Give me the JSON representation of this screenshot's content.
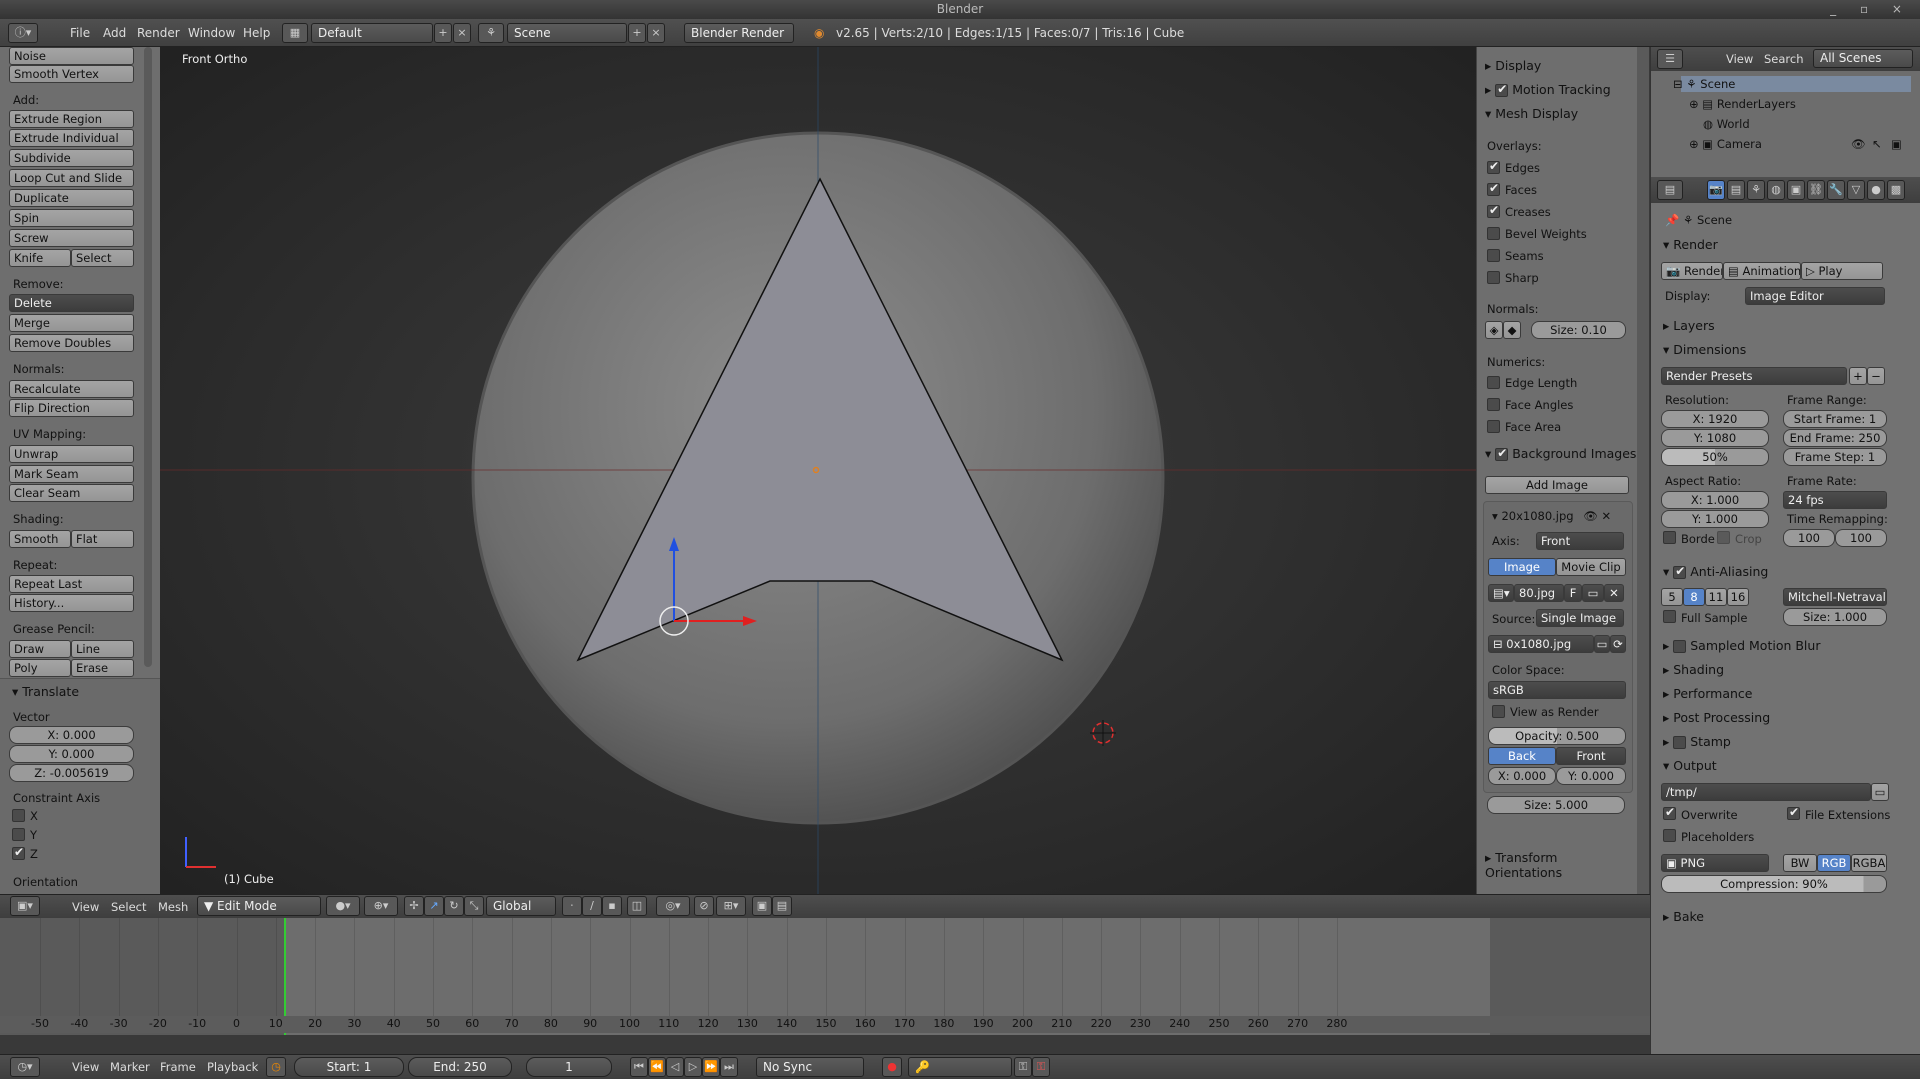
{
  "window": {
    "title": "Blender"
  },
  "topbar": {
    "menus": [
      "File",
      "Add",
      "Render",
      "Window",
      "Help"
    ],
    "layout": "Default",
    "scene": "Scene",
    "engine": "Blender Render",
    "stats": "v2.65 | Verts:2/10 | Edges:1/15 | Faces:0/7 | Tris:16 | Cube"
  },
  "toolshelf": {
    "top": [
      "Noise",
      "Smooth Vertex"
    ],
    "add_label": "Add:",
    "add": [
      "Extrude Region",
      "Extrude Individual",
      "Subdivide",
      "Loop Cut and Slide",
      "Duplicate",
      "Spin",
      "Screw"
    ],
    "knife": "Knife",
    "select": "Select",
    "remove_label": "Remove:",
    "delete": "Delete",
    "merge": "Merge",
    "remove_doubles": "Remove Doubles",
    "normals_label": "Normals:",
    "recalculate": "Recalculate",
    "flip": "Flip Direction",
    "uv_label": "UV Mapping:",
    "unwrap": "Unwrap",
    "mark_seam": "Mark Seam",
    "clear_seam": "Clear Seam",
    "shading_label": "Shading:",
    "smooth": "Smooth",
    "flat": "Flat",
    "repeat_label": "Repeat:",
    "repeat_last": "Repeat Last",
    "history": "History...",
    "gp_label": "Grease Pencil:",
    "draw": "Draw",
    "line": "Line",
    "poly": "Poly",
    "erase": "Erase"
  },
  "operator": {
    "title": "Translate",
    "vector_label": "Vector",
    "x": "X: 0.000",
    "y": "Y: 0.000",
    "z": "Z: -0.005619",
    "constraint_label": "Constraint Axis",
    "cx": "X",
    "cy": "Y",
    "cz": "Z",
    "orientation_label": "Orientation"
  },
  "viewport": {
    "view_name": "Front Ortho",
    "object": "(1) Cube"
  },
  "properties_n": {
    "display": "Display",
    "motion_tracking": "Motion Tracking",
    "mesh_display": "Mesh Display",
    "overlays": "Overlays:",
    "edges": "Edges",
    "faces": "Faces",
    "creases": "Creases",
    "bevel": "Bevel Weights",
    "seams": "Seams",
    "sharp": "Sharp",
    "normals": "Normals:",
    "size": "Size: 0.10",
    "numerics": "Numerics:",
    "edge_length": "Edge Length",
    "face_angles": "Face Angles",
    "face_area": "Face Area",
    "bg_images": "Background Images",
    "add_image": "Add Image",
    "img_name": "20x1080.jpg",
    "axis_label": "Axis:",
    "axis_value": "Front",
    "image_tab": "Image",
    "movie_tab": "Movie Clip",
    "img_field": "80.jpg",
    "f": "F",
    "source_label": "Source:",
    "source_value": "Single Image",
    "file": "0x1080.jpg",
    "colorspace_label": "Color Space:",
    "colorspace": "sRGB",
    "view_render": "View as Render",
    "opacity": "Opacity: 0.500",
    "back": "Back",
    "front": "Front",
    "ox": "X: 0.000",
    "oy": "Y: 0.000",
    "bsize": "Size: 5.000",
    "transform_orient": "Transform Orientations"
  },
  "outliner": {
    "view": "View",
    "search": "Search",
    "scenes": "All Scenes",
    "items": [
      "Scene",
      "RenderLayers",
      "World",
      "Camera"
    ]
  },
  "render_props": {
    "scene": "Scene",
    "render": "Render",
    "render_btn": "Render",
    "animation_btn": "Animation",
    "play_btn": "Play",
    "display_label": "Display:",
    "display_value": "Image Editor",
    "layers": "Layers",
    "dimensions": "Dimensions",
    "presets": "Render Presets",
    "resolution": "Resolution:",
    "res_x": "X: 1920",
    "res_y": "Y: 1080",
    "res_pct": "50%",
    "frame_range": "Frame Range:",
    "start": "Start Frame: 1",
    "end": "End Frame: 250",
    "step": "Frame Step: 1",
    "aspect": "Aspect Ratio:",
    "ax": "X: 1.000",
    "ay": "Y: 1.000",
    "frame_rate": "Frame Rate:",
    "fps": "24 fps",
    "time_remap": "Time Remapping:",
    "old": "100",
    "new": "100",
    "border": "Borde",
    "crop": "Crop",
    "aa": "Anti-Aliasing",
    "aa_vals": [
      "5",
      "8",
      "11",
      "16"
    ],
    "filter": "Mitchell-Netravali",
    "full_sample": "Full Sample",
    "aa_size": "Size: 1.000",
    "motion_blur": "Sampled Motion Blur",
    "shading": "Shading",
    "performance": "Performance",
    "post": "Post Processing",
    "stamp": "Stamp",
    "output": "Output",
    "path": "/tmp/",
    "overwrite": "Overwrite",
    "file_ext": "File Extensions",
    "placeholders": "Placeholders",
    "format": "PNG",
    "bw": "BW",
    "rgb": "RGB",
    "rgba": "RGBA",
    "compression": "Compression: 90%",
    "bake": "Bake"
  },
  "viewbar": {
    "view": "View",
    "select": "Select",
    "mesh": "Mesh",
    "mode": "Edit Mode",
    "orient": "Global"
  },
  "timeline": {
    "ticks": [
      "-50",
      "-40",
      "-30",
      "-20",
      "-10",
      "0",
      "10",
      "20",
      "30",
      "40",
      "50",
      "60",
      "70",
      "80",
      "90",
      "100",
      "110",
      "120",
      "130",
      "140",
      "150",
      "160",
      "170",
      "180",
      "190",
      "200",
      "210",
      "220",
      "230",
      "240",
      "250",
      "260",
      "270",
      "280"
    ],
    "view": "View",
    "marker": "Marker",
    "frame": "Frame",
    "playback": "Playback",
    "start": "Start: 1",
    "end": "End: 250",
    "current": "1",
    "sync": "No Sync"
  }
}
